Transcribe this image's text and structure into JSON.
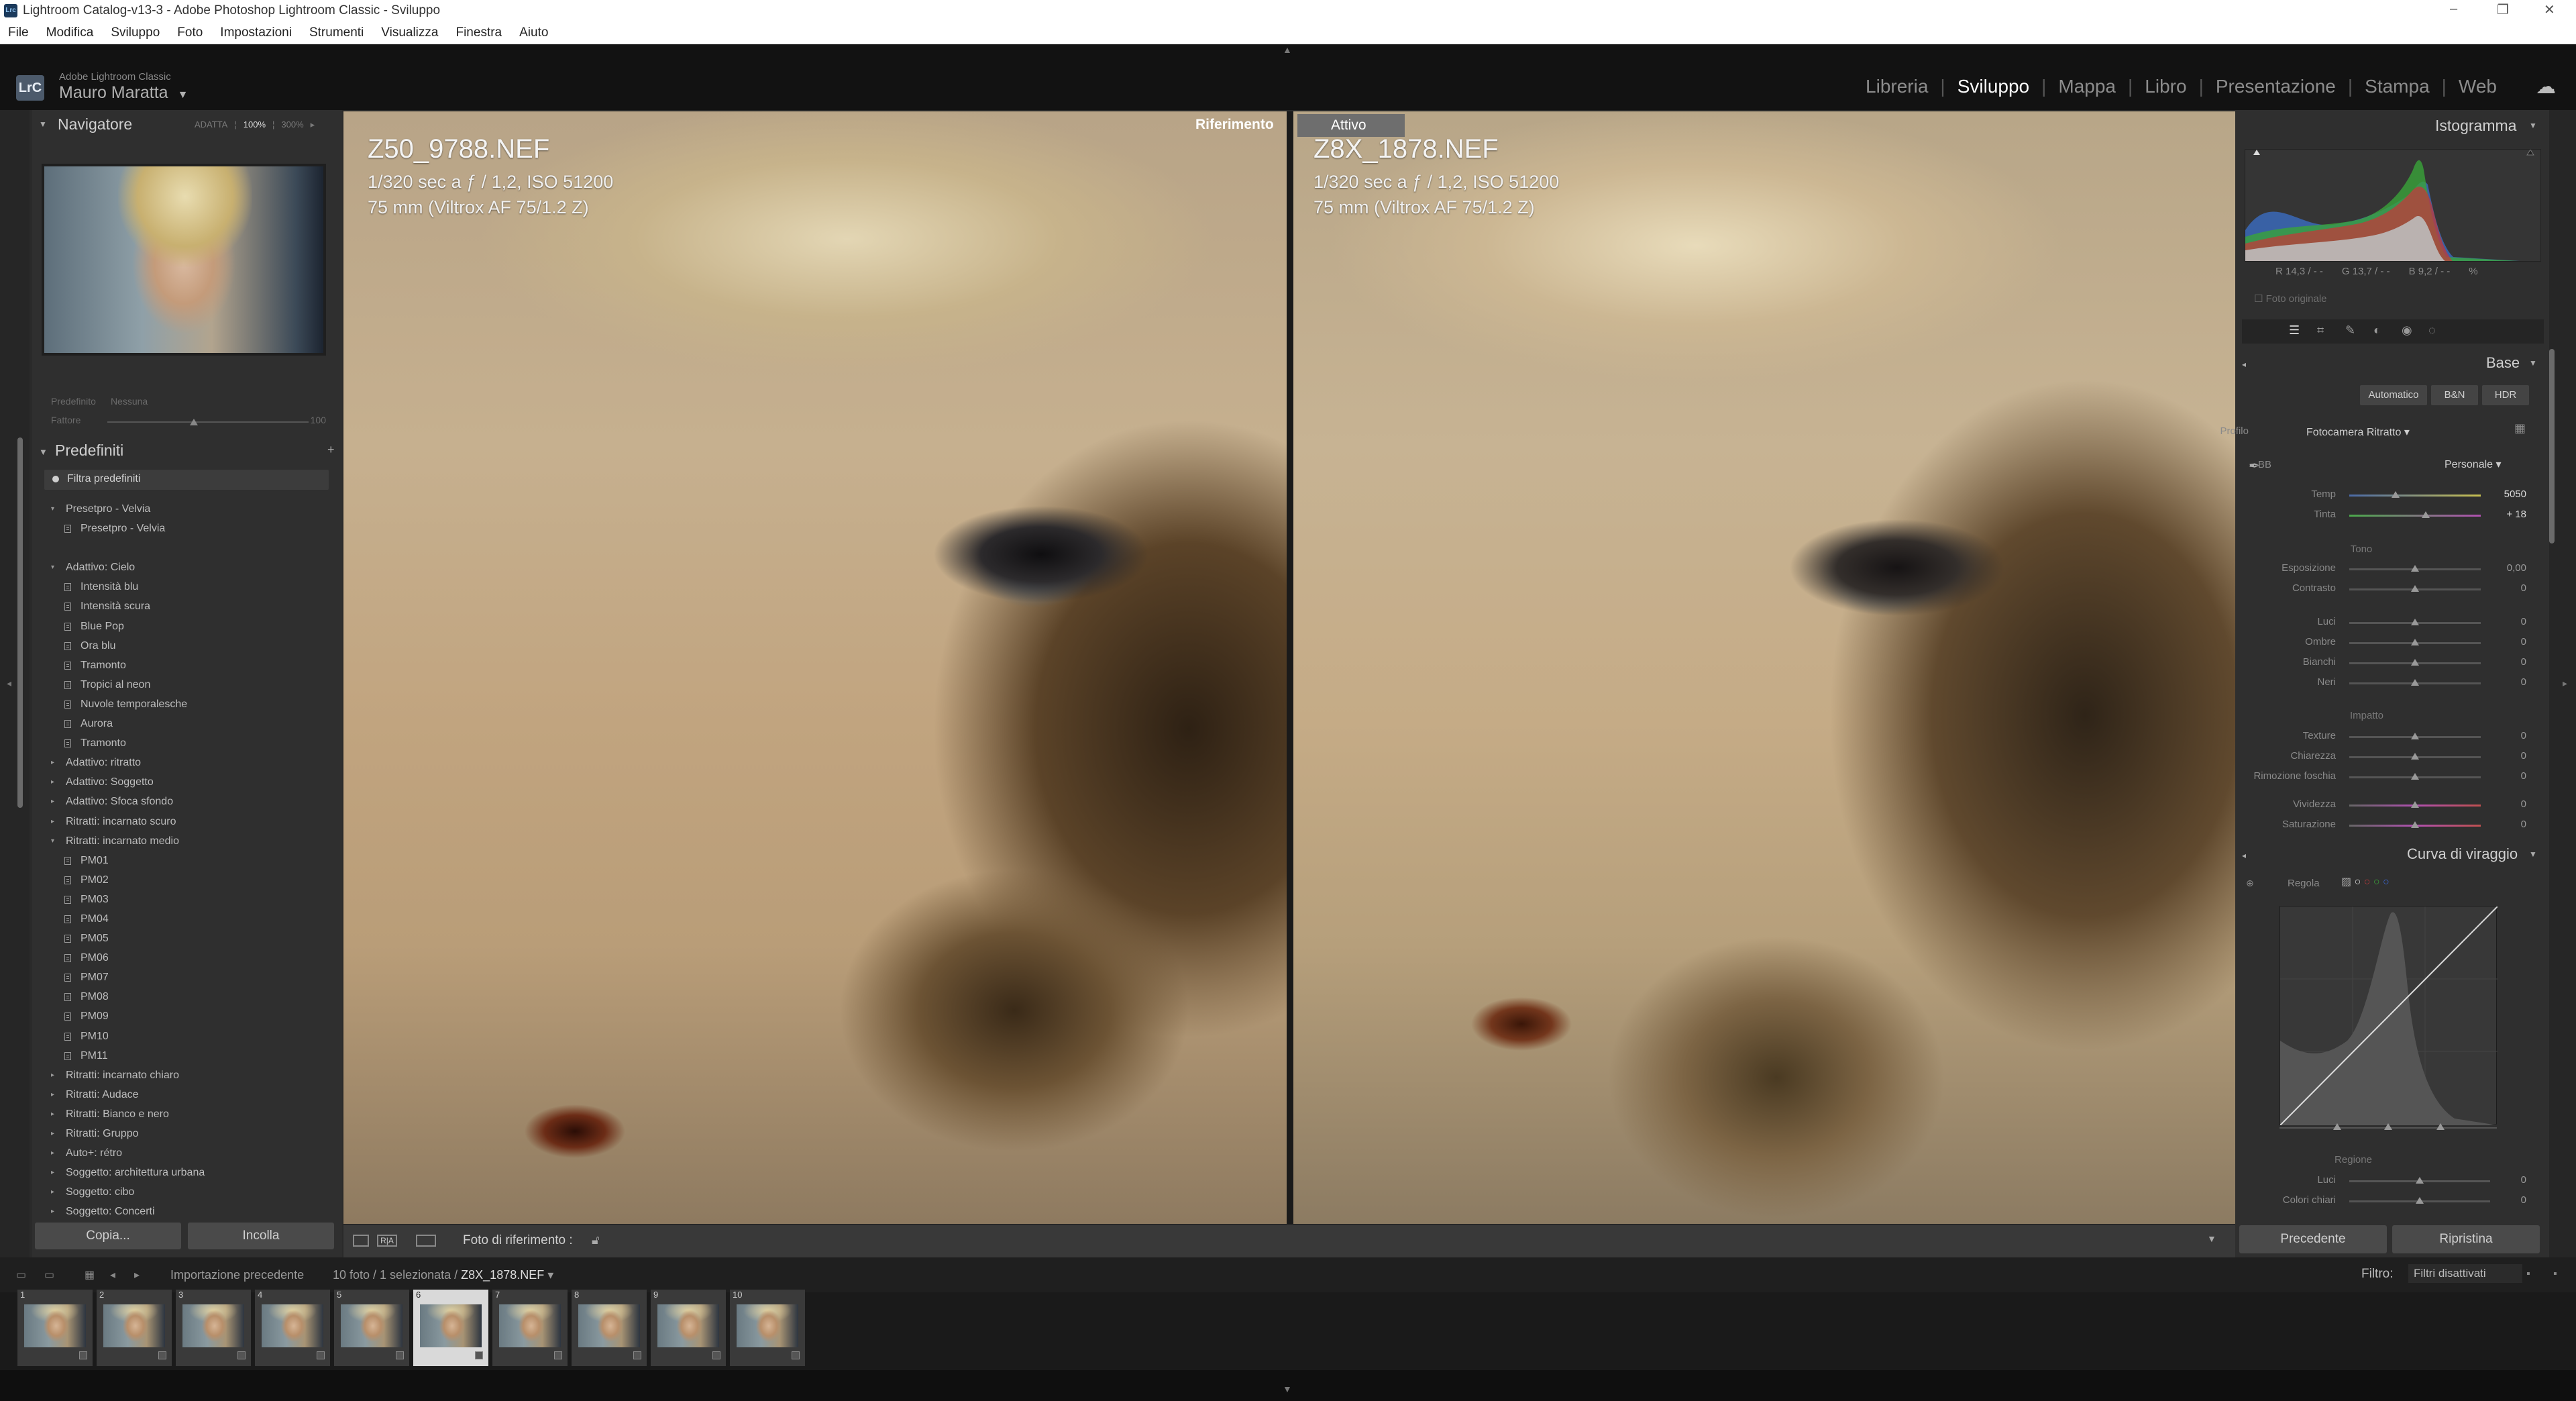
{
  "window": {
    "title": "Lightroom Catalog-v13-3 - Adobe Photoshop Lightroom Classic - Sviluppo",
    "icon": "Lrc",
    "controls": [
      "–",
      "❐",
      "✕"
    ]
  },
  "menu": [
    "File",
    "Modifica",
    "Sviluppo",
    "Foto",
    "Impostazioni",
    "Strumenti",
    "Visualizza",
    "Finestra",
    "Aiuto"
  ],
  "brand": {
    "logo": "LrC",
    "product": "Adobe Lightroom Classic",
    "user": "Mauro Maratta",
    "arrow": "▼"
  },
  "modules": [
    {
      "label": "Libreria",
      "active": false
    },
    {
      "label": "Sviluppo",
      "active": true
    },
    {
      "label": "Mappa",
      "active": false
    },
    {
      "label": "Libro",
      "active": false
    },
    {
      "label": "Presentazione",
      "active": false
    },
    {
      "label": "Stampa",
      "active": false
    },
    {
      "label": "Web",
      "active": false
    }
  ],
  "navigator": {
    "title": "Navigatore",
    "zoom_fit": "ADATTA",
    "zoom_100": "100%",
    "zoom_300": "300%"
  },
  "preset_info": {
    "preset_label": "Predefinito",
    "preset_value": "Nessuna",
    "amount_label": "Fattore",
    "amount_value": "100"
  },
  "presets": {
    "title": "Predefiniti",
    "add": "+",
    "filter": "Filtra predefiniti",
    "items": [
      {
        "type": "group",
        "open": true,
        "label": "Presetpro - Velvia"
      },
      {
        "type": "item",
        "label": "Presetpro - Velvia"
      },
      {
        "type": "spacer",
        "label": ""
      },
      {
        "type": "group",
        "open": true,
        "label": "Adattivo: Cielo"
      },
      {
        "type": "item",
        "label": "Intensità blu"
      },
      {
        "type": "item",
        "label": "Intensità scura"
      },
      {
        "type": "item",
        "label": "Blue Pop"
      },
      {
        "type": "item",
        "label": "Ora blu"
      },
      {
        "type": "item",
        "label": "Tramonto"
      },
      {
        "type": "item",
        "label": "Tropici al neon"
      },
      {
        "type": "item",
        "label": "Nuvole temporalesche"
      },
      {
        "type": "item",
        "label": "Aurora"
      },
      {
        "type": "item",
        "label": "Tramonto"
      },
      {
        "type": "group",
        "open": false,
        "label": "Adattivo: ritratto"
      },
      {
        "type": "group",
        "open": false,
        "label": "Adattivo: Soggetto"
      },
      {
        "type": "group",
        "open": false,
        "label": "Adattivo: Sfoca sfondo"
      },
      {
        "type": "group",
        "open": false,
        "label": "Ritratti: incarnato scuro"
      },
      {
        "type": "group",
        "open": true,
        "label": "Ritratti: incarnato medio"
      },
      {
        "type": "item",
        "label": "PM01"
      },
      {
        "type": "item",
        "label": "PM02"
      },
      {
        "type": "item",
        "label": "PM03"
      },
      {
        "type": "item",
        "label": "PM04"
      },
      {
        "type": "item",
        "label": "PM05"
      },
      {
        "type": "item",
        "label": "PM06"
      },
      {
        "type": "item",
        "label": "PM07"
      },
      {
        "type": "item",
        "label": "PM08"
      },
      {
        "type": "item",
        "label": "PM09"
      },
      {
        "type": "item",
        "label": "PM10"
      },
      {
        "type": "item",
        "label": "PM11"
      },
      {
        "type": "group",
        "open": false,
        "label": "Ritratti: incarnato chiaro"
      },
      {
        "type": "group",
        "open": false,
        "label": "Ritratti: Audace"
      },
      {
        "type": "group",
        "open": false,
        "label": "Ritratti: Bianco e nero"
      },
      {
        "type": "group",
        "open": false,
        "label": "Ritratti: Gruppo"
      },
      {
        "type": "group",
        "open": false,
        "label": "Auto+: rétro"
      },
      {
        "type": "group",
        "open": false,
        "label": "Soggetto: architettura urbana"
      },
      {
        "type": "group",
        "open": false,
        "label": "Soggetto: cibo"
      },
      {
        "type": "group",
        "open": false,
        "label": "Soggetto: Concerti"
      }
    ]
  },
  "left_buttons": {
    "copy": "Copia...",
    "paste": "Incolla"
  },
  "reference_photo": {
    "label": "Riferimento",
    "filename": "Z50_9788.NEF",
    "exposure": "1/320 sec a ƒ / 1,2, ISO 51200",
    "lens": "75 mm (Viltrox AF 75/1.2 Z)"
  },
  "active_photo": {
    "label": "Attivo",
    "filename": "Z8X_1878.NEF",
    "exposure": "1/320 sec a ƒ / 1,2, ISO 51200",
    "lens": "75 mm (Viltrox AF 75/1.2 Z)"
  },
  "toolbar": {
    "ref_mode": "R|A",
    "ref_label": "Foto di riferimento :",
    "menu_arrow": "▼"
  },
  "histogram": {
    "title": "Istogramma",
    "readout_r": "R   14,3 / - -",
    "readout_g": "G   13,7 / - -",
    "readout_b": "B   9,2 / - -",
    "readout_pct": "%",
    "original": "Foto originale"
  },
  "basic": {
    "title": "Base",
    "auto": "Automatico",
    "bw": "B&N",
    "hdr": "HDR",
    "profile_label": "Profilo",
    "profile_value": "Fotocamera Ritratto",
    "wb_label": "BB",
    "wb_value": "Personale",
    "tone_label": "Tono",
    "presence_label": "Impatto",
    "sliders": [
      {
        "label": "Temp",
        "value": "5050",
        "pos": 0.35
      },
      {
        "label": "Tinta",
        "value": "+ 18",
        "pos": 0.58
      },
      {
        "label": "Esposizione",
        "value": "0,00",
        "pos": 0.5
      },
      {
        "label": "Contrasto",
        "value": "0",
        "pos": 0.5
      },
      {
        "label": "Luci",
        "value": "0",
        "pos": 0.5
      },
      {
        "label": "Ombre",
        "value": "0",
        "pos": 0.5
      },
      {
        "label": "Bianchi",
        "value": "0",
        "pos": 0.5
      },
      {
        "label": "Neri",
        "value": "0",
        "pos": 0.5
      },
      {
        "label": "Texture",
        "value": "0",
        "pos": 0.5
      },
      {
        "label": "Chiarezza",
        "value": "0",
        "pos": 0.5
      },
      {
        "label": "Rimozione foschia",
        "value": "0",
        "pos": 0.5
      },
      {
        "label": "Vividezza",
        "value": "0",
        "pos": 0.5
      },
      {
        "label": "Saturazione",
        "value": "0",
        "pos": 0.5
      }
    ]
  },
  "tone_curve": {
    "title": "Curva di viraggio",
    "adjust_label": "Regola",
    "region_label": "Regione",
    "sliders": [
      {
        "label": "Luci",
        "value": "0",
        "pos": 0.5
      },
      {
        "label": "Colori chiari",
        "value": "0",
        "pos": 0.5
      }
    ]
  },
  "right_buttons": {
    "previous": "Precedente",
    "reset": "Ripristina"
  },
  "filmbar": {
    "source": "Importazione precedente",
    "count": "10 foto / 1 selezionata /",
    "current": "Z8X_1878.NEF",
    "filter_label": "Filtro:",
    "filter_value": "Filtri disattivati"
  },
  "filmstrip": {
    "selected_index": 5,
    "thumbs": [
      "1",
      "2",
      "3",
      "4",
      "5",
      "6",
      "7",
      "8",
      "9",
      "10"
    ]
  },
  "colors": {
    "accent_active_label": "#6e6e6e",
    "panel_bg": "#2f2f2f",
    "topbar_bg": "#121212"
  }
}
